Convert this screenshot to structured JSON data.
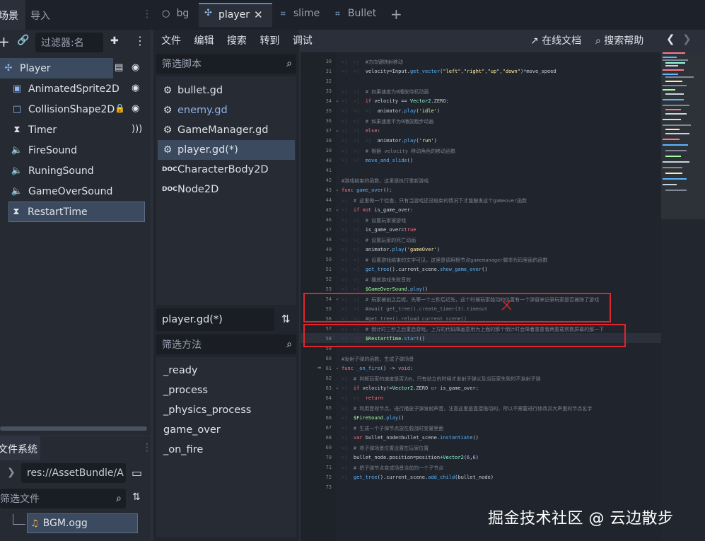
{
  "dock_tabs": {
    "scene": "场景",
    "import": "导入"
  },
  "editor_tabs": [
    {
      "label": "bg",
      "icon": "circle-icon"
    },
    {
      "label": "player",
      "icon": "node-icon",
      "active": true
    },
    {
      "label": "slime",
      "icon": "node-icon"
    },
    {
      "label": "Bullet",
      "icon": "node-icon"
    }
  ],
  "scene_filter_placeholder": "过滤器:名",
  "scene_tree": [
    {
      "label": "Player",
      "icon": "player-icon",
      "extra": [
        "script-icon",
        "eye-icon"
      ]
    },
    {
      "label": "AnimatedSprite2D",
      "icon": "animated-sprite-icon",
      "extra": [
        "eye-icon"
      ]
    },
    {
      "label": "CollisionShape2D",
      "icon": "collision-shape-icon",
      "extra": [
        "lock-icon",
        "eye-icon"
      ]
    },
    {
      "label": "Timer",
      "icon": "timer-icon",
      "extra": [
        "signal-icon"
      ]
    },
    {
      "label": "FireSound",
      "icon": "audio-icon",
      "extra": []
    },
    {
      "label": "RuningSound",
      "icon": "audio-icon",
      "extra": []
    },
    {
      "label": "GameOverSound",
      "icon": "audio-icon",
      "extra": []
    },
    {
      "label": "RestartTime",
      "icon": "timer-icon",
      "extra": [],
      "selected": true
    }
  ],
  "filesystem": {
    "title": "文件系统",
    "path": "res://AssetBundle/A",
    "filter_placeholder": "筛选文件",
    "file": "BGM.ogg"
  },
  "menu": [
    "文件",
    "编辑",
    "搜索",
    "转到",
    "调试"
  ],
  "toolbar_right": {
    "online_docs": "在线文档",
    "search_help": "搜索帮助"
  },
  "scripts": {
    "filter_placeholder": "筛选脚本",
    "items": [
      {
        "label": "bullet.gd",
        "icon": "gear-icon"
      },
      {
        "label": "enemy.gd",
        "icon": "gear-icon",
        "highlight": true
      },
      {
        "label": "GameManager.gd",
        "icon": "gear-icon"
      },
      {
        "label": "player.gd(*)",
        "icon": "gear-icon",
        "selected": true
      },
      {
        "label": "CharacterBody2D",
        "icon": "doc-icon"
      },
      {
        "label": "Node2D",
        "icon": "doc-icon"
      }
    ]
  },
  "current_script": "player.gd(*)",
  "methods": {
    "filter_placeholder": "筛选方法",
    "items": [
      "_ready",
      "_process",
      "_physics_process",
      "game_over",
      "_on_fire"
    ]
  },
  "watermark": "掘金技术社区 @ 云边散步"
}
